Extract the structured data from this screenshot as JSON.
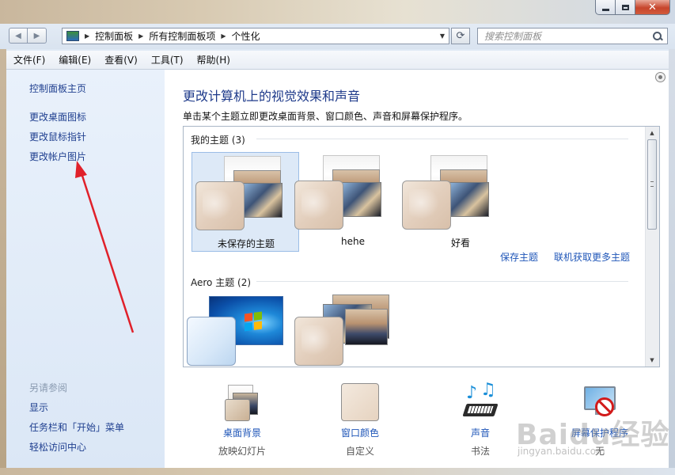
{
  "window": {
    "minimize_icon": "minimize-icon",
    "maximize_icon": "maximize-icon",
    "close_icon": "close-icon",
    "close_glyph": "✕"
  },
  "nav": {
    "back_glyph": "◀",
    "forward_glyph": "▶",
    "breadcrumbs": [
      "控制面板",
      "所有控制面板项",
      "个性化"
    ],
    "refresh_glyph": "⟳",
    "search_placeholder": "搜索控制面板"
  },
  "menu": [
    "文件(F)",
    "编辑(E)",
    "查看(V)",
    "工具(T)",
    "帮助(H)"
  ],
  "sidebar": {
    "home": "控制面板主页",
    "links": [
      "更改桌面图标",
      "更改鼠标指针",
      "更改帐户图片"
    ],
    "see_also_heading": "另请参阅",
    "see_also": [
      "显示",
      "任务栏和「开始」菜单",
      "轻松访问中心"
    ]
  },
  "main": {
    "title": "更改计算机上的视觉效果和声音",
    "description": "单击某个主题立即更改桌面背景、窗口颜色、声音和屏幕保护程序。",
    "my_themes_heading": "我的主题 (3)",
    "my_themes": [
      {
        "name": "未保存的主题",
        "selected": true
      },
      {
        "name": "hehe",
        "selected": false
      },
      {
        "name": "好看",
        "selected": false
      }
    ],
    "save_theme": "保存主题",
    "get_more_themes": "联机获取更多主题",
    "aero_heading": "Aero 主题 (2)"
  },
  "options": [
    {
      "title": "桌面背景",
      "subtitle": "放映幻灯片",
      "icon": "desktop-background-icon"
    },
    {
      "title": "窗口颜色",
      "subtitle": "自定义",
      "icon": "window-color-icon"
    },
    {
      "title": "声音",
      "subtitle": "书法",
      "icon": "sound-icon"
    },
    {
      "title": "屏幕保护程序",
      "subtitle": "无",
      "icon": "screensaver-icon"
    }
  ],
  "watermark": {
    "text": "Baidu经验",
    "sub": "jingyan.baidu.com"
  },
  "colors": {
    "link": "#1f56b8",
    "title": "#1e3a8a",
    "sidebar_bg": "#e4eefa",
    "annotation_arrow": "#e0202a",
    "selection": "#dde9f7"
  }
}
